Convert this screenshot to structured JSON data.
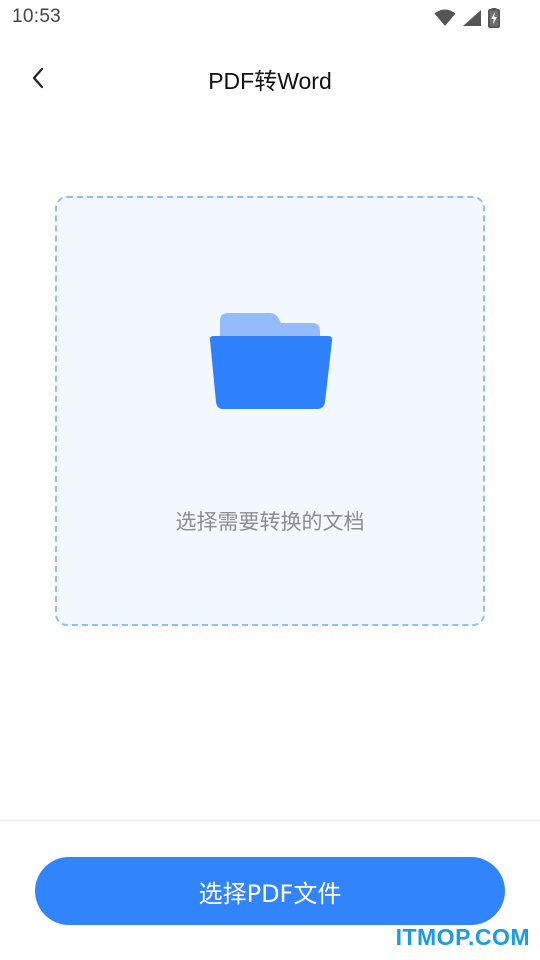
{
  "status_bar": {
    "time": "10:53",
    "icons": [
      "wifi-icon",
      "cellular-signal-icon",
      "battery-charging-icon"
    ]
  },
  "header": {
    "title": "PDF转Word",
    "back_icon": "chevron-left-icon"
  },
  "drop_zone": {
    "icon": "folder-icon",
    "hint": "选择需要转换的文档"
  },
  "footer": {
    "button_label": "选择PDF文件"
  },
  "watermark": {
    "text": "ITMOP.COM"
  },
  "colors": {
    "accent": "#3184fc",
    "folder_front": "#2f80fb",
    "folder_back": "#94bcfc",
    "drop_zone_border": "#8fbef8",
    "drop_zone_bg": "#f3f8fe",
    "hint_text": "#8a8d93",
    "watermark": "#1a9be8"
  }
}
